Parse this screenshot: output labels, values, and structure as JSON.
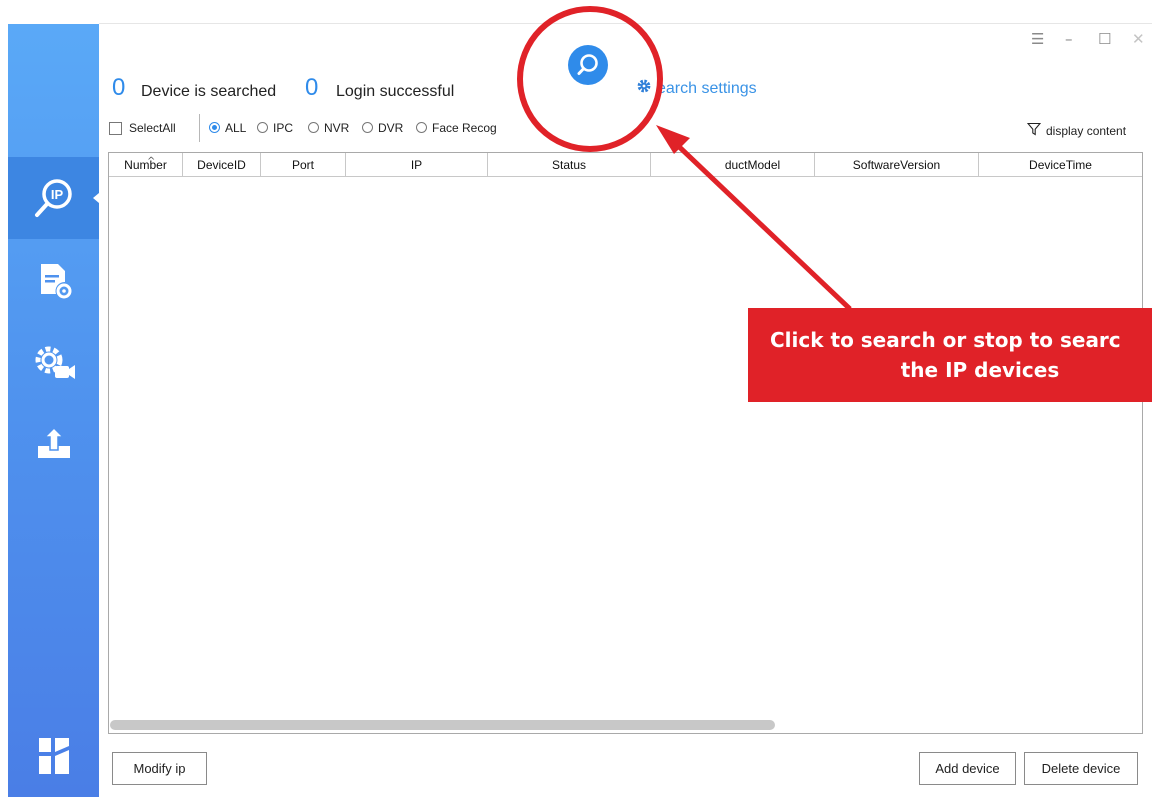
{
  "window": {
    "controls": {
      "menu_glyph": "☰",
      "minimize_glyph": "–",
      "maximize_glyph": "☐",
      "close_glyph": "✕"
    }
  },
  "sidebar": {
    "items": [
      {
        "icon": "ip-search-icon",
        "active": true
      },
      {
        "icon": "document-settings-icon",
        "active": false
      },
      {
        "icon": "camera-settings-icon",
        "active": false
      },
      {
        "icon": "upload-icon",
        "active": false
      }
    ],
    "logo_icon": "app-logo-icon"
  },
  "header": {
    "searched_count": "0",
    "searched_label": "Device is searched",
    "login_count": "0",
    "login_label": "Login successful",
    "search_settings_label": "earch settings"
  },
  "filter": {
    "select_all_label": "SelectAll",
    "options": [
      "ALL",
      "IPC",
      "NVR",
      "DVR",
      "Face Recog"
    ],
    "selected": "ALL",
    "display_content_label": "display content"
  },
  "table": {
    "columns": [
      "Number",
      "DeviceID",
      "Port",
      "IP",
      "Status",
      "ductModel",
      "SoftwareVersion",
      "DeviceTime"
    ],
    "rows": []
  },
  "footer": {
    "modify_ip_label": "Modify ip",
    "add_device_label": "Add device",
    "delete_device_label": "Delete device"
  },
  "annotation": {
    "callout_line1": "Click to search or stop to searc",
    "callout_line2": "the IP devices",
    "color": "#e02228"
  },
  "colors": {
    "accent": "#2f8bea",
    "sidebar_top": "#5aa9f7",
    "sidebar_bottom": "#4a7ee6"
  }
}
